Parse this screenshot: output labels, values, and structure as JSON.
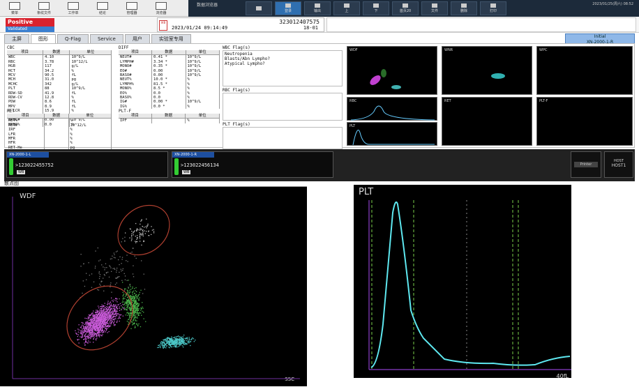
{
  "toolbar": {
    "buttons": [
      "菜单",
      "条纹文件",
      "工作单",
      "结论",
      "管理器",
      "浏览器"
    ],
    "window_title": "数据浏览器",
    "device_buttons": [
      "",
      "登录",
      "输出",
      "上",
      "下",
      "首页20",
      "文件",
      "删除",
      "打印"
    ],
    "date": "2023/01/25(周六) 08:52"
  },
  "status": {
    "result": "Positive",
    "sub": "Error Comm",
    "validated": "Validated"
  },
  "sample": {
    "id": "323012407575",
    "datetime": "2023/01/24 09:14:49",
    "rack": "18-01",
    "mode": "WB"
  },
  "tabs": [
    "主屏",
    "图形",
    "Q-Flag",
    "Service",
    "用户",
    "实验室专用"
  ],
  "initial": {
    "label": "Initial",
    "analyzer": "XN-2000-1-R"
  },
  "cbc": {
    "title": "CBC",
    "headers": [
      "项目",
      "数据",
      "单位"
    ],
    "rows": [
      [
        "WBC",
        "4.10",
        "10^9/L"
      ],
      [
        "RBC",
        "3.78",
        "10^12/L"
      ],
      [
        "HGB",
        "117",
        "g/L"
      ],
      [
        "HCT",
        "34.2",
        "%"
      ],
      [
        "MCV",
        "90.5",
        "fL"
      ],
      [
        "MCH",
        "31.0",
        "pg"
      ],
      [
        "MCHC",
        "342",
        "g/L"
      ],
      [
        "PLT",
        "88",
        "10^9/L"
      ],
      [
        "RDW-SD",
        "41.9",
        "fL"
      ],
      [
        "RDW-CV",
        "12.8",
        "%"
      ],
      [
        "PDW",
        "8.6",
        "fL"
      ],
      [
        "MPV",
        "8.9",
        "fL"
      ],
      [
        "P-LCR",
        "15.9",
        "%"
      ],
      [
        "PCT",
        "0.08",
        "%"
      ],
      [
        "NRBC#",
        "0.00",
        "10^9/L"
      ],
      [
        "NRBC%",
        "0.0",
        "%"
      ]
    ]
  },
  "diff": {
    "title": "DIFF",
    "headers": [
      "项目",
      "数据",
      "单位"
    ],
    "rows": [
      [
        "NEUT#",
        "0.41 *",
        "10^9/L"
      ],
      [
        "LYMPH#",
        "3.34 *",
        "10^9/L"
      ],
      [
        "MONO#",
        "0.35 *",
        "10^9/L"
      ],
      [
        "EO#",
        "0.00",
        "10^9/L"
      ],
      [
        "BASO#",
        "0.00",
        "10^9/L"
      ],
      [
        "NEUT%",
        "10.0 *",
        "%"
      ],
      [
        "LYMPH%",
        "81.5 *",
        "%"
      ],
      [
        "MONO%",
        "8.5 *",
        "%"
      ],
      [
        "EO%",
        "0.0",
        "%"
      ],
      [
        "BASO%",
        "0.0",
        "%"
      ],
      [
        "IG#",
        "0.00 *",
        "10^9/L"
      ],
      [
        "IG%",
        "0.0 *",
        "%"
      ]
    ]
  },
  "ret": {
    "title": "RET",
    "headers": [
      "项目",
      "数据",
      "单位"
    ],
    "rows": [
      [
        "RET%",
        "",
        "%"
      ],
      [
        "RET#",
        "",
        "10^12/L"
      ],
      [
        "IRF",
        "",
        "%"
      ],
      [
        "LFR",
        "",
        "%"
      ],
      [
        "MFR",
        "",
        "%"
      ],
      [
        "HFR",
        "",
        "%"
      ],
      [
        "RET-He",
        "",
        "pg"
      ]
    ]
  },
  "pltf": {
    "title": "PLT-F",
    "headers": [
      "项目",
      "数据",
      "单位"
    ],
    "rows": [
      [
        "IPF",
        "",
        "%"
      ]
    ]
  },
  "flags": {
    "wbc_title": "WBC Flag(s)",
    "wbc": [
      "Neutropenia",
      "Blasts/Abn Lympho?",
      "Atypical Lympho?"
    ],
    "rbc_title": "RBC Flag(s)",
    "plt_title": "PLT Flag(s)"
  },
  "spectra": {
    "wdf": "WDF",
    "wnr": "WNR",
    "wpc": "WPC",
    "rbc": "RBC",
    "ret": "RET",
    "pltf": "PLT-F",
    "plt": "PLT"
  },
  "analyzers": [
    {
      "name": "XN-2000-1-L",
      "sample": ">123022455752",
      "mode": "WB"
    },
    {
      "name": "XN-2000-1-R",
      "sample": ">123022456134",
      "mode": "WB"
    }
  ],
  "host": {
    "label": "HOST",
    "name": "HOST1",
    "printer": "Printer"
  },
  "big_scatter": {
    "caption": "散点图",
    "label": "WDF",
    "axis": "SSC"
  },
  "big_plt": {
    "label": "PLT",
    "axis": "40fL"
  }
}
